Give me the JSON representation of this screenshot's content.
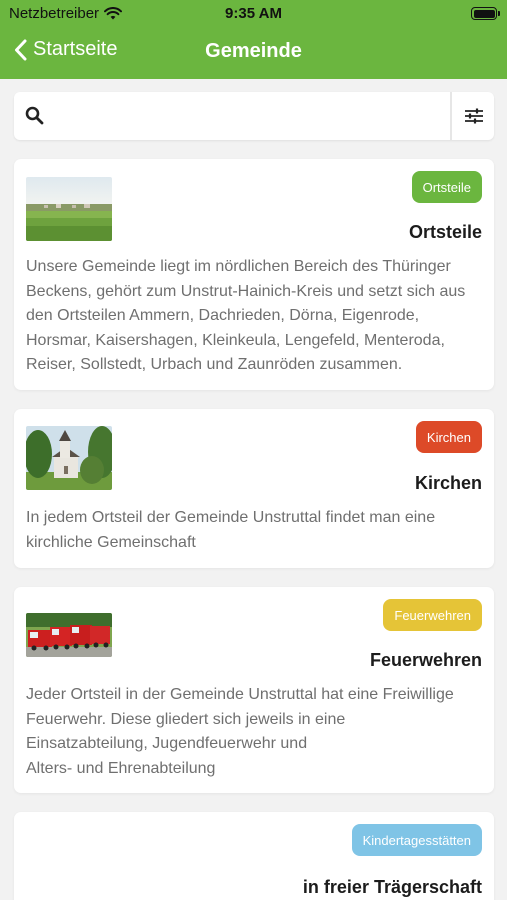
{
  "status_bar": {
    "carrier": "Netzbetreiber",
    "time": "9:35 AM"
  },
  "nav": {
    "back_label": "Startseite",
    "title": "Gemeinde"
  },
  "search": {
    "placeholder": "",
    "value": ""
  },
  "colors": {
    "header": "#6bb63f",
    "ortsteile": "#6bb63f",
    "kirchen": "#dd4a28",
    "feuerwehren": "#e5c437",
    "kita": "#7fc4e6"
  },
  "cards": [
    {
      "badge": "Ortsteile",
      "title": "Ortsteile",
      "description": "Unsere Gemeinde liegt im nördlichen Bereich des Thüringer Beckens, gehört zum Unstrut-Hainich-Kreis und setzt sich aus den Ortsteilen Ammern, Dachrieden, Dörna, Eigenrode, Horsmar, Kaisershagen, Kleinkeula, Lengefeld, Menteroda, Reiser, Sollstedt, Urbach und Zaunröden zusammen."
    },
    {
      "badge": "Kirchen",
      "title": "Kirchen",
      "description": "In jedem Ortsteil der Gemeinde Unstruttal findet man eine kirchliche Gemeinschaft"
    },
    {
      "badge": "Feuerwehren",
      "title": "Feuerwehren",
      "description_lines": [
        "Jeder Ortsteil in der Gemeinde Unstruttal hat eine Freiwillige",
        "Feuerwehr. Diese gliedert sich jeweils in eine",
        "Einsatzabteilung, Jugendfeuerwehr und",
        "Alters- und Ehrenabteilung"
      ]
    },
    {
      "badge": "Kindertagesstätten",
      "title": "in freier Trägerschaft"
    }
  ]
}
